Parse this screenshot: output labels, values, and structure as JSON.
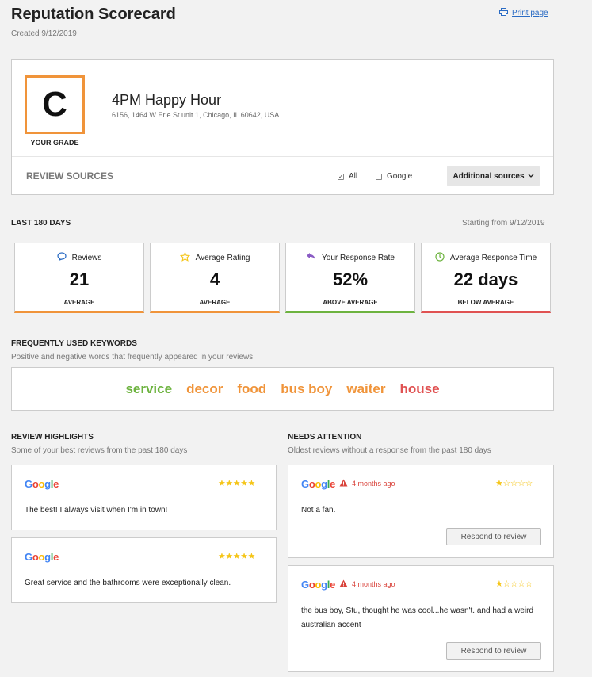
{
  "header": {
    "title": "Reputation Scorecard",
    "created": "Created 9/12/2019",
    "print_label": "Print page"
  },
  "business": {
    "grade": "C",
    "grade_label": "YOUR GRADE",
    "name": "4PM Happy Hour",
    "address": "6156, 1464 W Erie St unit 1, Chicago, IL 60642, USA"
  },
  "review_sources": {
    "label": "REVIEW SOURCES",
    "options": [
      {
        "label": "All",
        "checked": true
      },
      {
        "label": "Google",
        "checked": false
      }
    ],
    "additional_label": "Additional sources"
  },
  "period": {
    "label": "LAST 180 DAYS",
    "starting": "Starting from 9/12/2019"
  },
  "stats": [
    {
      "title": "Reviews",
      "value": "21",
      "sub": "AVERAGE",
      "color": "#f0943a",
      "icon": "chat-bubble-icon"
    },
    {
      "title": "Average Rating",
      "value": "4",
      "sub": "AVERAGE",
      "color": "#f0943a",
      "icon": "star-outline-icon"
    },
    {
      "title": "Your Response Rate",
      "value": "52%",
      "sub": "ABOVE AVERAGE",
      "color": "#6db33f",
      "icon": "reply-arrow-icon"
    },
    {
      "title": "Average Response Time",
      "value": "22 days",
      "sub": "BELOW AVERAGE",
      "color": "#e05252",
      "icon": "clock-icon"
    }
  ],
  "keywords": {
    "title": "FREQUENTLY USED KEYWORDS",
    "subtitle": "Positive and negative words that frequently appeared in your reviews",
    "items": [
      {
        "word": "service",
        "color": "#6db33f"
      },
      {
        "word": "decor",
        "color": "#f0943a"
      },
      {
        "word": "food",
        "color": "#f0943a"
      },
      {
        "word": "bus boy",
        "color": "#f0943a"
      },
      {
        "word": "waiter",
        "color": "#f0943a"
      },
      {
        "word": "house",
        "color": "#e05252"
      }
    ]
  },
  "highlights": {
    "title": "REVIEW HIGHLIGHTS",
    "subtitle": "Some of your best reviews from the past 180 days",
    "reviews": [
      {
        "source": "Google",
        "rating": 5,
        "text": "The best! I always visit when I'm in town!"
      },
      {
        "source": "Google",
        "rating": 5,
        "text": "Great service and the bathrooms were exceptionally clean."
      }
    ]
  },
  "attention": {
    "title": "NEEDS ATTENTION",
    "subtitle": "Oldest reviews without a response from the past 180 days",
    "reviews": [
      {
        "source": "Google",
        "age": "4 months ago",
        "rating": 1,
        "text": "Not a fan.",
        "button": "Respond to review"
      },
      {
        "source": "Google",
        "age": "4 months ago",
        "rating": 1,
        "text": "the bus boy, Stu, thought he was cool...he wasn't. and had a weird australian accent",
        "button": "Respond to review"
      }
    ]
  },
  "colors": {
    "grade_border": "#f0943a",
    "link": "#2b6cc4",
    "star": "#f5c518",
    "warning": "#d9423a"
  }
}
